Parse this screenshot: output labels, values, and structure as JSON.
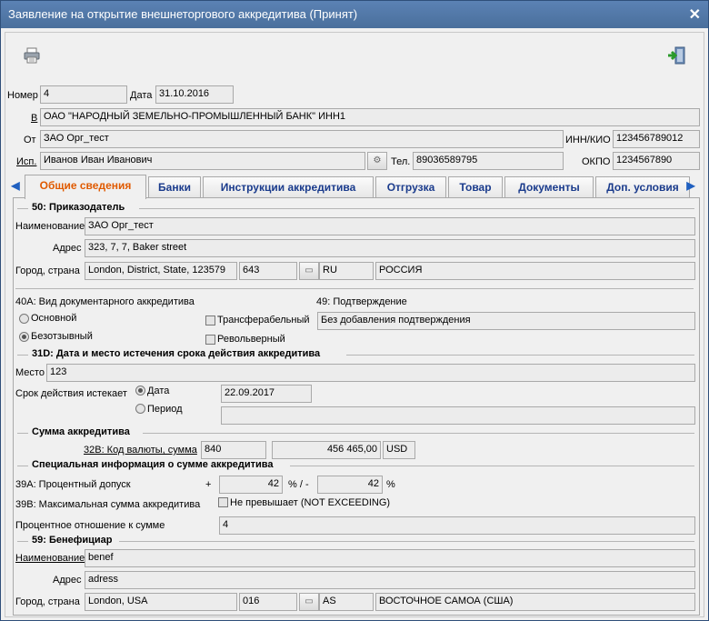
{
  "window": {
    "title": "Заявление на открытие внешнеторгового аккредитива (Принят)"
  },
  "toolbar": {
    "print_icon": "printer-icon",
    "exit_icon": "exit-door-icon"
  },
  "header": {
    "number_label": "Номер",
    "number_value": "4",
    "date_label": "Дата",
    "date_value": "31.10.2016",
    "to_label": "В",
    "to_value": "ОАО \"НАРОДНЫЙ ЗЕМЕЛЬНО-ПРОМЫШЛЕННЫЙ БАНК\" ИНН1",
    "from_label": "От",
    "from_value": "ЗАО Орг_тест",
    "inn_label": "ИНН/КИО",
    "inn_value": "123456789012",
    "executor_label": "Исп.",
    "executor_value": "Иванов Иван Иванович",
    "phone_label": "Тел.",
    "phone_value": "89036589795",
    "okpo_label": "ОКПО",
    "okpo_value": "1234567890"
  },
  "tabs": [
    {
      "label": "Общие сведения",
      "active": true
    },
    {
      "label": "Банки"
    },
    {
      "label": "Инструкции аккредитива"
    },
    {
      "label": "Отгрузка"
    },
    {
      "label": "Товар"
    },
    {
      "label": "Документы"
    },
    {
      "label": "Доп. условия"
    }
  ],
  "principal": {
    "section": "50: Приказодатель",
    "name_label": "Наименование",
    "name_value": "ЗАО Орг_тест",
    "address_label": "Адрес",
    "address_value": "323, 7, 7, Baker street",
    "city_label": "Город, страна",
    "city_value": "London, District, State, 123579",
    "country_code": "643",
    "country_alpha": "RU",
    "country_name": "РОССИЯ"
  },
  "lc_type": {
    "label": "40A: Вид документарного аккредитива",
    "opt_basic": "Основной",
    "opt_irrevocable": "Безотзывный",
    "selected": "Безотзывный",
    "transferable": "Трансферабельный",
    "revolving": "Револьверный",
    "confirmation_label": "49: Подтверждение",
    "confirmation_value": "Без добавления подтверждения"
  },
  "expiry": {
    "section": "31D: Дата и место истечения срока действия аккредитива",
    "place_label": "Место",
    "place_value": "123",
    "expires_label": "Срок действия истекает",
    "opt_date": "Дата",
    "opt_period": "Период",
    "selected": "Дата",
    "date_value": "22.09.2017",
    "period_value": ""
  },
  "amount": {
    "section": "Сумма аккредитива",
    "code_label": "32B: Код валюты, сумма",
    "code_value": "840",
    "sum_value": "456 465,00",
    "currency": "USD"
  },
  "special": {
    "section": "Специальная информация о сумме аккредитива",
    "tolerance_label": "39A: Процентный допуск",
    "plus": "+",
    "plus_value": "42",
    "pm": "% / -",
    "minus_value": "42",
    "pct": "%",
    "max_label": "39B: Максимальная сумма аккредитива",
    "not_exceeding": "Не превышает (NOT EXCEEDING)",
    "ratio_label": "Процентное отношение к сумме",
    "ratio_value": "4"
  },
  "beneficiary": {
    "section": "59: Бенефициар",
    "name_label": "Наименование",
    "name_value": "benef",
    "address_label": "Адрес",
    "address_value": "adress",
    "city_label": "Город, страна",
    "city_value": "London, USA",
    "country_code": "016",
    "country_alpha": "AS",
    "country_name": "ВОСТОЧНОЕ САМОА (США)"
  }
}
